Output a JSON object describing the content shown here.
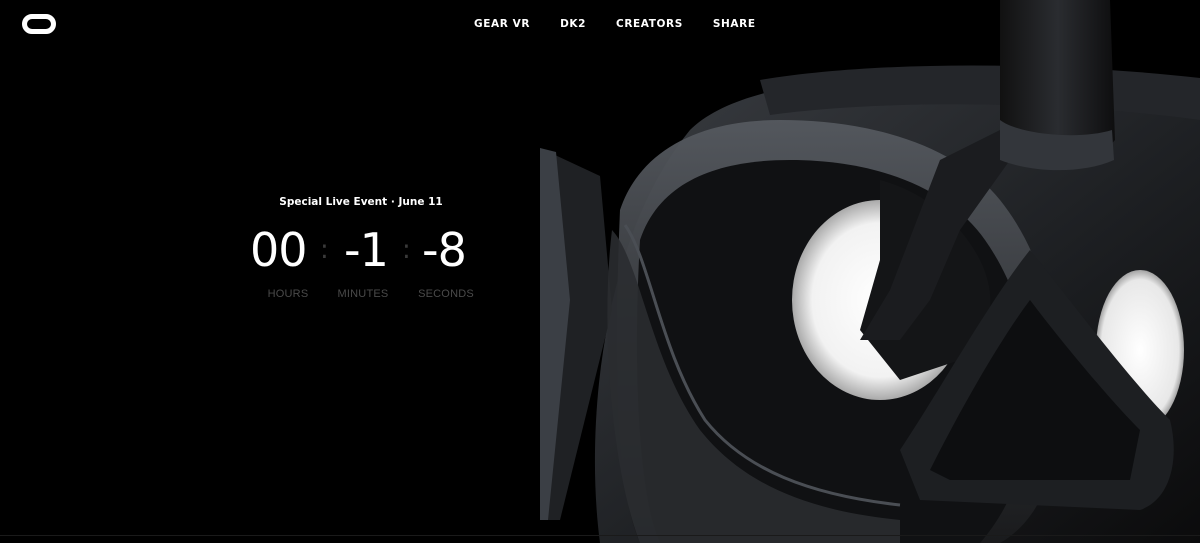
{
  "nav": {
    "items": [
      {
        "label": "GEAR VR"
      },
      {
        "label": "DK2"
      },
      {
        "label": "CREATORS"
      },
      {
        "label": "SHARE"
      }
    ]
  },
  "event": {
    "title": "Special Live Event · June 11"
  },
  "countdown": {
    "hours": "00",
    "minutes": "-1",
    "seconds": "-8",
    "hours_label": "HOURS",
    "minutes_label": "MINUTES",
    "seconds_label": "SECONDS",
    "separator": ":"
  },
  "colors": {
    "background": "#000000",
    "text": "#ffffff",
    "muted": "#4a4a4a"
  },
  "icons": {
    "logo": "oculus-logo-icon"
  }
}
